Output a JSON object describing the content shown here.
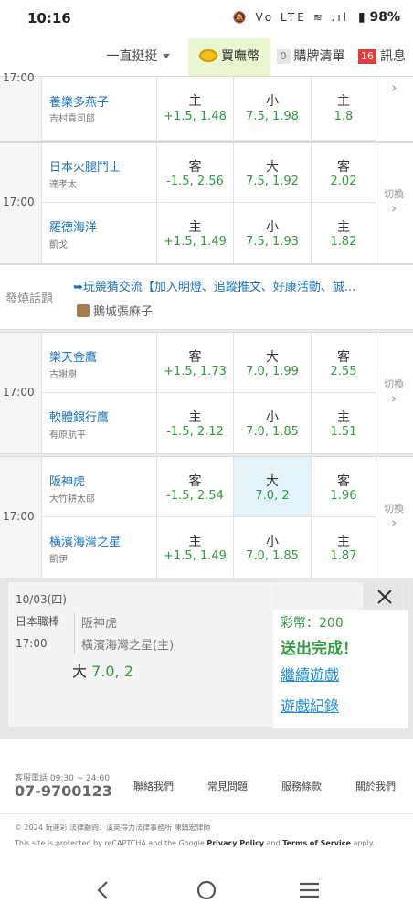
{
  "status": {
    "time": "10:16",
    "icons": "🔕 Vo LTE ≋ .ıl",
    "battery": "▮ 98%"
  },
  "topbar": {
    "selector_label": "一直挺挺",
    "buy_label": "買嘸幣",
    "cart_count": "0",
    "cart_label": "購牌清單",
    "msg_count": "16",
    "msg_label": "訊息"
  },
  "games": [
    {
      "time": "17:00",
      "rows": [
        {
          "team": "養樂多燕子",
          "pitcher": "吉村貢司郎",
          "c1_side": "主",
          "c1_line": "+1.5, 1.48",
          "c2_side": "小",
          "c2_line": "7.5, 1.98",
          "c3_side": "主",
          "c3_line": "1.8"
        }
      ]
    },
    {
      "time": "17:00",
      "swap": "切換",
      "rows": [
        {
          "team": "日本火腿鬥士",
          "pitcher": "達孝太",
          "c1_side": "客",
          "c1_line": "-1.5, 2.56",
          "c2_side": "大",
          "c2_line": "7.5, 1.92",
          "c3_side": "客",
          "c3_line": "2.02"
        },
        {
          "team": "羅德海洋",
          "pitcher": "凱戈",
          "c1_side": "主",
          "c1_line": "+1.5, 1.49",
          "c2_side": "小",
          "c2_line": "7.5, 1.93",
          "c3_side": "主",
          "c3_line": "1.82"
        }
      ]
    },
    {
      "time": "17:00",
      "swap": "切換",
      "rows": [
        {
          "team": "樂天金鷹",
          "pitcher": "古謝樹",
          "c1_side": "客",
          "c1_line": "+1.5, 1.73",
          "c2_side": "大",
          "c2_line": "7.0, 1.99",
          "c3_side": "客",
          "c3_line": "2.55"
        },
        {
          "team": "軟體銀行鷹",
          "pitcher": "有原航平",
          "c1_side": "主",
          "c1_line": "-1.5, 2.12",
          "c2_side": "小",
          "c2_line": "7.0, 1.85",
          "c3_side": "主",
          "c3_line": "1.51"
        }
      ]
    },
    {
      "time": "17:00",
      "swap": "切換",
      "rows": [
        {
          "team": "阪神虎",
          "pitcher": "大竹耕太郎",
          "c1_side": "客",
          "c1_line": "-1.5, 2.54",
          "c2_side": "大",
          "c2_line": "7.0, 2",
          "c3_side": "客",
          "c3_line": "1.96"
        },
        {
          "team": "橫濱海灣之星",
          "pitcher": "凱伊",
          "c1_side": "主",
          "c1_line": "+1.5, 1.49",
          "c2_side": "小",
          "c2_line": "7.0, 1.85",
          "c3_side": "主",
          "c3_line": "1.87"
        }
      ]
    }
  ],
  "hot": {
    "label": "發燒話題",
    "title": "➥玩競猜交流【加入明燈、追蹤推文、好康活動、誠...",
    "user": "鵝城張麻子"
  },
  "panel": {
    "date": "10/03(四)",
    "league": "日本職棒",
    "time": "17:00",
    "team1": "阪神虎",
    "team2": "橫濱海灣之星(主)",
    "bet_side": "大",
    "bet_value": "7.0, 2",
    "coins": "彩幣：200",
    "done": "送出完成！",
    "continue": "繼續遊戲",
    "record": "遊戲紀錄"
  },
  "footer": {
    "tel_label": "客服電話 09:30 ~ 24:00",
    "tel": "07-9700123",
    "links": [
      "聯絡我們",
      "常見問題",
      "服務條款",
      "關於我們"
    ],
    "copyright": "© 2024 玩運彩  法律顧問：漢英得力法律事務所 陳鎮宏律師",
    "recaptcha_pre": "This site is protected by reCAPTCHA and the Google ",
    "privacy": "Privacy Policy",
    "and": " and ",
    "terms": "Terms of Service",
    "apply": " apply."
  },
  "colors": {
    "team": "#1b72b9",
    "odds": "#2f9b3e",
    "buy_bg": "#e9f6d0",
    "selected_cell": "#e3f3fb"
  }
}
